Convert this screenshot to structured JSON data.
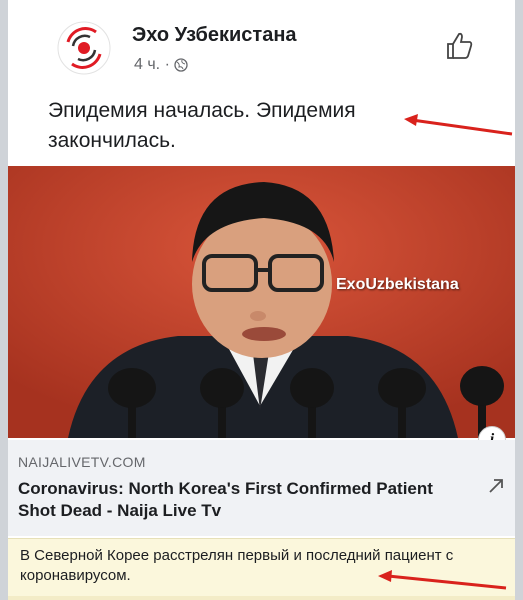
{
  "post": {
    "page_name": "Эхо Узбекистана",
    "time": "4 ч. ·",
    "text": "Эпидемия началась. Эпидемия закончилась."
  },
  "photo": {
    "watermark": "ExoUzbekistana"
  },
  "link": {
    "domain": "NAIJALIVETV.COM",
    "title": "Coronavirus: North Korea's First Confirmed Patient Shot Dead - Naija Live Tv"
  },
  "caption": {
    "text": "В Северной Корее расстрелян первый и последний пациент с коронавирусом."
  },
  "icons": {
    "avatar": "echo-logo-icon",
    "privacy": "globe-icon",
    "like": "thumbs-up-icon",
    "info": "info-icon",
    "external": "external-link-icon"
  },
  "colors": {
    "annotation_arrow": "#d9221c",
    "background_red": "#c8432f"
  }
}
